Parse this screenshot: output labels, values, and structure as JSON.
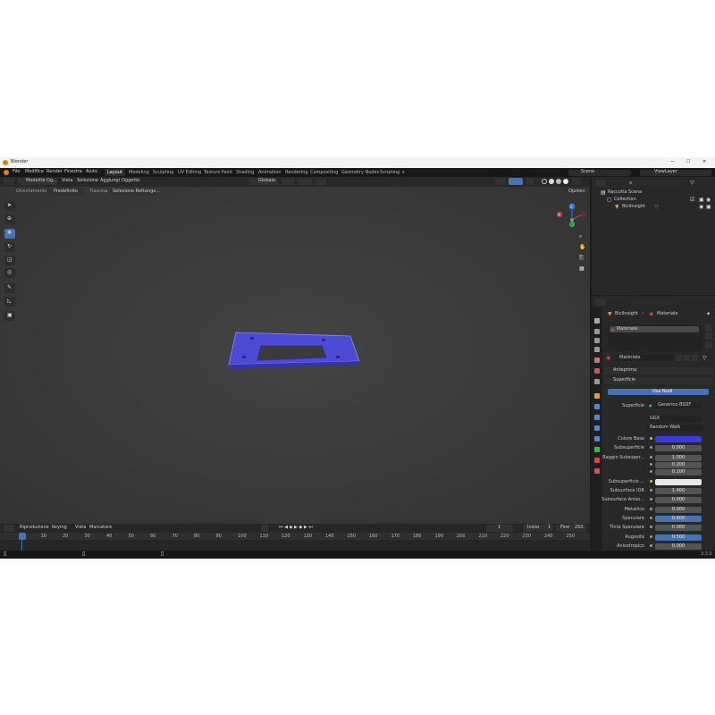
{
  "window": {
    "title": "Blender",
    "minimize": "—",
    "maximize": "☐",
    "close": "✕"
  },
  "menu": [
    "File",
    "Modifica",
    "Render",
    "Finestra",
    "Aiuto"
  ],
  "workspaces": [
    "Layout",
    "Modeling",
    "Sculpting",
    "UV Editing",
    "Texture Paint",
    "Shading",
    "Animation",
    "Rendering",
    "Compositing",
    "Geometry Nodes",
    "Scripting"
  ],
  "workspace_add": "+",
  "scene": {
    "label": "Scene",
    "view_layer": "ViewLayer"
  },
  "viewport_header": {
    "mode": "Modalità Og...",
    "menus": [
      "Vista",
      "Selezione",
      "Aggiungi",
      "Oggetto"
    ],
    "transform_orientation": "Globale",
    "orientation_label": "Orientamento",
    "orientation_value": "Predefinito",
    "drag_label": "Trascina",
    "drag_value": "Selezione Rettango...",
    "options": "Opzioni"
  },
  "gizmo": {
    "x": "X",
    "y": "Y",
    "z": "Z"
  },
  "model_color": "#4a4ad6",
  "timeline": {
    "menus": [
      "Riproduzione",
      "Keying",
      "Vista",
      "Marcatore"
    ],
    "current_frame": "1",
    "start_label": "Inizio",
    "start": "1",
    "end_label": "Fine",
    "end": "250",
    "ticks": [
      "1",
      "10",
      "20",
      "30",
      "40",
      "50",
      "60",
      "70",
      "80",
      "90",
      "100",
      "110",
      "120",
      "130",
      "140",
      "150",
      "160",
      "170",
      "180",
      "190",
      "200",
      "210",
      "220",
      "230",
      "240",
      "250"
    ]
  },
  "outliner": {
    "root": "Raccolta Scena",
    "collection": "Collection",
    "object": "BiciInsight"
  },
  "properties": {
    "breadcrumb_object": "BiciInsight",
    "breadcrumb_material": "Materiale",
    "slot": "Materiale",
    "material_name": "Materiale",
    "sections": {
      "preview": "Anteprima",
      "surface": "Superficie"
    },
    "use_nodes": "Usa Nodi",
    "surface_label": "Superficie",
    "surface_value": "Generico BSDF",
    "distribution": "GGX",
    "subsurface_method": "Random Walk",
    "rows": [
      {
        "label": "Colore Base",
        "value": "",
        "kind": "color"
      },
      {
        "label": "Subsuperficie",
        "value": "0.000",
        "kind": "num"
      },
      {
        "label": "Raggio Subsuper...",
        "value": "1.000",
        "kind": "num"
      },
      {
        "label": "",
        "value": "0.200",
        "kind": "num"
      },
      {
        "label": "",
        "value": "0.100",
        "kind": "num"
      },
      {
        "label": "Subsuperficie ...",
        "value": "",
        "kind": "white"
      },
      {
        "label": "Subsurface IOR",
        "value": "1.400",
        "kind": "num"
      },
      {
        "label": "Subsurface Aniso...",
        "value": "0.000",
        "kind": "num"
      },
      {
        "label": "Metallico",
        "value": "0.000",
        "kind": "num"
      },
      {
        "label": "Speculare",
        "value": "0.500",
        "kind": "blue"
      },
      {
        "label": "Tinta Speculare",
        "value": "0.000",
        "kind": "num"
      },
      {
        "label": "Rugosità",
        "value": "0.500",
        "kind": "blue"
      },
      {
        "label": "Anisotropico",
        "value": "0.000",
        "kind": "num"
      }
    ],
    "base_color": "#3b3bd9"
  },
  "status": {
    "version": "3.3.0"
  }
}
